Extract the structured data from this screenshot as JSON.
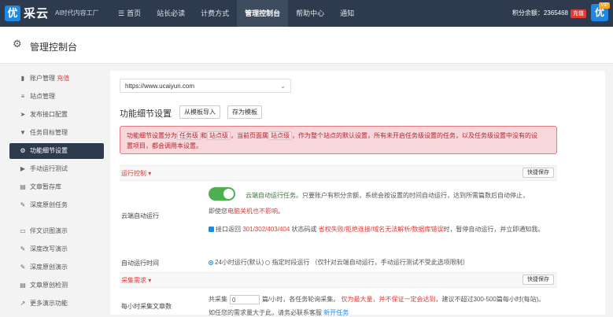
{
  "topbar": {
    "logo_char": "优",
    "logo_name": "采云",
    "slogan": "AI时代内容工厂",
    "nav": [
      {
        "icon": "menu-icon",
        "glyph": "☰",
        "label": "首页"
      },
      {
        "label": "站长必读"
      },
      {
        "label": "计费方式"
      },
      {
        "label": "管理控制台",
        "active": true
      },
      {
        "label": "帮助中心"
      },
      {
        "label": "通知"
      }
    ],
    "balance_text": "积分余额：2365468",
    "recharge_label": "充值",
    "avatar_char": "优",
    "vip_label": "VIP"
  },
  "page": {
    "title": "管理控制台"
  },
  "sidebar": {
    "items": [
      {
        "icon": "bar-chart-icon",
        "glyph": "▮",
        "label": "账户管理",
        "extra": "充值"
      },
      {
        "icon": "sliders-icon",
        "glyph": "≡",
        "label": "站点管理"
      },
      {
        "icon": "send-icon",
        "glyph": "➤",
        "label": "发布接口配置"
      },
      {
        "icon": "filter-icon",
        "glyph": "▼",
        "label": "任务目标管理"
      },
      {
        "icon": "gears-icon",
        "glyph": "⚙",
        "label": "功能细节设置",
        "active": true
      },
      {
        "icon": "play-icon",
        "glyph": "▶",
        "label": "手动运行测试"
      },
      {
        "icon": "document-icon",
        "glyph": "▤",
        "label": "文章暂存库"
      },
      {
        "icon": "edit-icon",
        "glyph": "✎",
        "label": "深度原创任务"
      }
    ],
    "demo_items": [
      {
        "icon": "desktop-icon",
        "glyph": "▭",
        "label": "伴文识图演示"
      },
      {
        "icon": "edit-icon",
        "glyph": "✎",
        "label": "深度改写演示"
      },
      {
        "icon": "edit-icon",
        "glyph": "✎",
        "label": "深度原创演示"
      },
      {
        "icon": "document-icon",
        "glyph": "▤",
        "label": "文章原创检测"
      },
      {
        "icon": "share-icon",
        "glyph": "↗",
        "label": "更多演示功能"
      }
    ]
  },
  "main": {
    "url_value": "https://www.ucaiyun.com",
    "section_title": "功能细节设置",
    "import_button": "从模板导入",
    "save_template_button": "存为模板",
    "alert": {
      "line1_a": "功能细节设置分为",
      "tag1": "任务级",
      "line1_b": "和",
      "tag2": "站点级",
      "line1_c": "，当前页面属",
      "tag3": "站点级",
      "line1_d": "，作为整个站点的默认设置，所有未开启任务级设置的任务，以及任务级设置中没有的设",
      "line2": "置项目，都会调用本设置。"
    },
    "run_control": {
      "title": "运行控制 ▾",
      "quick_button": "快捷保存",
      "cloud_label": "云端自动运行",
      "cloud_text_green": "云端自动运行任务。",
      "cloud_text_rest": "只要账户有积分余额，系统会按设置的时间自动运行，达到所需篇数后自动停止，",
      "cloud_line2_a": "即使您",
      "cloud_line2_red": "电脑关机也不影响",
      "cloud_line2_b": "。",
      "interface_a": "接口返回",
      "interface_codes": "301/302/403/404",
      "interface_b": "状态码或",
      "interface_red": "省权失败/拒绝连接/域名无法解析/数据库错误",
      "interface_c": "时，暂停自动运行，并立即通知我。",
      "time_label": "自动运行时间",
      "radio1": "24小时运行(默认)",
      "radio2": "指定时段运行",
      "time_note": "（仅针对云端自动运行，手动运行测试不受此选项限制）"
    },
    "collect": {
      "title": "采集需求 ▾",
      "quick_button": "快捷保存",
      "label": "每小时采集文章数",
      "text_a": "共采集",
      "input_value": "0",
      "text_b": "篇/小时，各任务轮询采集。",
      "text_red": "仅为最大量，并不保证一定会达到",
      "text_c": "，建议不超过300-500篇每小时(每站)。",
      "line2_a": "如任您的需求量大于此，请务必联系客服",
      "line2_link": "新开任务"
    }
  }
}
